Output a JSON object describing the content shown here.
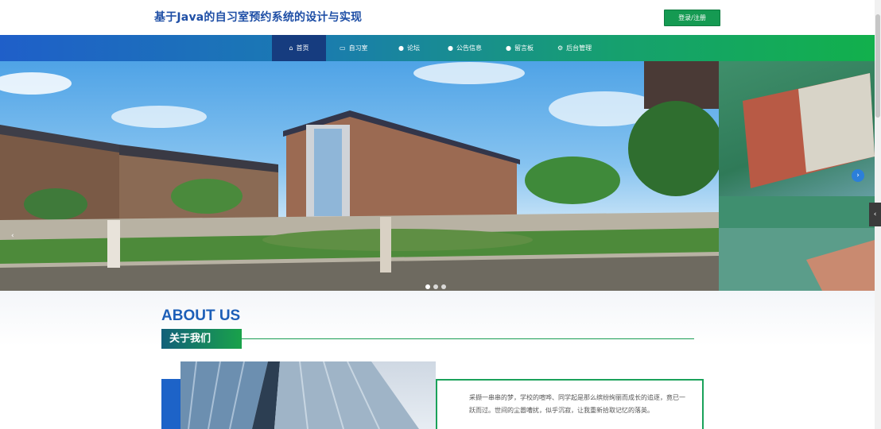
{
  "header": {
    "site_title": "基于Java的自习室预约系统的设计与实现",
    "login_label": "登录/注册"
  },
  "nav": {
    "items": [
      {
        "label": "首页",
        "icon": "home-icon"
      },
      {
        "label": "自习室",
        "icon": "bag-icon"
      },
      {
        "label": "论坛",
        "icon": "circle-icon"
      },
      {
        "label": "公告信息",
        "icon": "circle-icon"
      },
      {
        "label": "留言板",
        "icon": "circle-icon"
      },
      {
        "label": "后台管理",
        "icon": "settings-icon"
      }
    ],
    "active_index": 0
  },
  "banner": {
    "slide_count": 3,
    "active_slide": 0,
    "prev_symbol": "‹",
    "next_symbol": "›"
  },
  "about": {
    "heading_en": "ABOUT US",
    "heading_cn": "关于我们",
    "paragraph": "采撷一串串的梦，学校的喧哗、同学起是那么缤纷绚丽而成长的追逐，竟已一跃而过。世间的尘嚣嘈扰，似乎沉寂，让我重新拾取记忆的落英。"
  },
  "colors": {
    "title_blue": "#1f4fa6",
    "nav_gradient_start": "#1f5fc9",
    "nav_gradient_end": "#12b04c",
    "nav_active": "#163c7f",
    "login_green": "#159a52",
    "about_blue": "#1d5fb8",
    "accent_green": "#1aa25a"
  }
}
